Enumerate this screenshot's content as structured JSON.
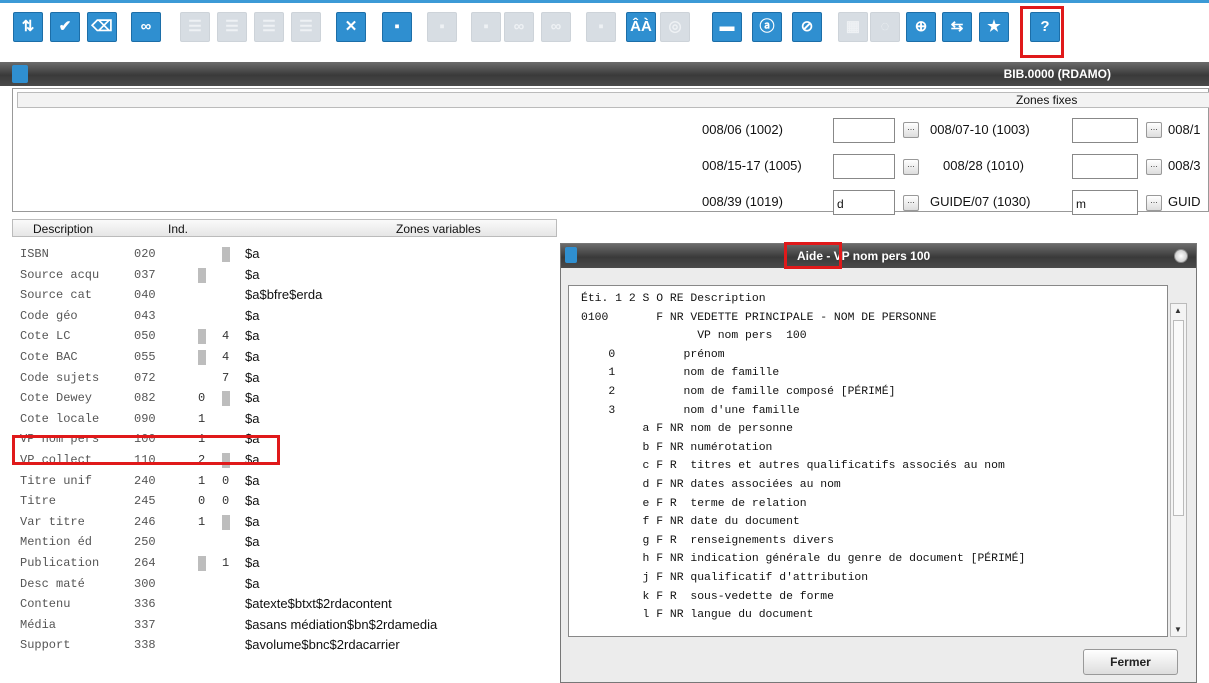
{
  "toolbar": {
    "buttons": [
      {
        "name": "import-icon",
        "glyph": "⇅"
      },
      {
        "name": "validate-icon",
        "glyph": "✔"
      },
      {
        "name": "eraser-icon",
        "glyph": "⌫"
      },
      {
        "name": "binoculars-icon",
        "glyph": "∞"
      },
      {
        "name": "list-icon",
        "glyph": "☰"
      },
      {
        "name": "list-icon",
        "glyph": "☰"
      },
      {
        "name": "list-icon",
        "glyph": "☰"
      },
      {
        "name": "list-indent-icon",
        "glyph": "☰"
      },
      {
        "name": "delete-record-icon",
        "glyph": "✕"
      },
      {
        "name": "record-icon",
        "glyph": "▪"
      },
      {
        "name": "record-icon",
        "glyph": "▪"
      },
      {
        "name": "record-icon",
        "glyph": "▪"
      },
      {
        "name": "binoculars-icon",
        "glyph": "∞"
      },
      {
        "name": "binoculars-icon",
        "glyph": "∞"
      },
      {
        "name": "record-icon",
        "glyph": "▪"
      },
      {
        "name": "accents-icon",
        "glyph": "ÂÀ"
      },
      {
        "name": "circle-icon",
        "glyph": "◎"
      },
      {
        "name": "save-icon",
        "glyph": "▬"
      },
      {
        "name": "subfield-a-icon",
        "glyph": "ⓐ"
      },
      {
        "name": "subfield-disabled-icon",
        "glyph": "⊘"
      },
      {
        "name": "grid-icon",
        "glyph": "▦"
      },
      {
        "name": "globe-icon",
        "glyph": "◌"
      },
      {
        "name": "url-globe-icon",
        "glyph": "⊕"
      },
      {
        "name": "transfer-icon",
        "glyph": "⇆"
      },
      {
        "name": "star-icon",
        "glyph": "★"
      },
      {
        "name": "help-icon",
        "glyph": "?"
      }
    ]
  },
  "main": {
    "title": "BIB.0000 (RDAMO)"
  },
  "fixed": {
    "header": "Zones fixes",
    "fields": [
      {
        "label": "008/06 (1002)",
        "value": ""
      },
      {
        "label": "008/07-10 (1003)",
        "value": ""
      },
      {
        "label": "008/1",
        "value": ""
      },
      {
        "label": "008/15-17 (1005)",
        "value": ""
      },
      {
        "label": "008/28 (1010)",
        "value": ""
      },
      {
        "label": "008/3",
        "value": ""
      },
      {
        "label": "008/39 (1019)",
        "value": "d"
      },
      {
        "label": "GUIDE/07 (1030)",
        "value": "m"
      },
      {
        "label": "GUID",
        "value": ""
      }
    ]
  },
  "columns": {
    "description": "Description",
    "ind": "Ind.",
    "zones": "Zones variables"
  },
  "rows": [
    {
      "desc": "ISBN",
      "code": "020",
      "i1": "",
      "i2": "",
      "s1": false,
      "s2": true,
      "zone": "$a"
    },
    {
      "desc": "Source acqu",
      "code": "037",
      "i1": "",
      "i2": "",
      "s1": true,
      "s2": false,
      "zone": "$a"
    },
    {
      "desc": "Source cat",
      "code": "040",
      "i1": "",
      "i2": "",
      "s1": false,
      "s2": false,
      "zone": "$a$bfre$erda"
    },
    {
      "desc": "Code géo",
      "code": "043",
      "i1": "",
      "i2": "",
      "s1": false,
      "s2": false,
      "zone": "$a"
    },
    {
      "desc": "Cote LC",
      "code": "050",
      "i1": "",
      "i2": "4",
      "s1": true,
      "s2": false,
      "zone": "$a"
    },
    {
      "desc": "Cote BAC",
      "code": "055",
      "i1": "",
      "i2": "4",
      "s1": true,
      "s2": false,
      "zone": "$a"
    },
    {
      "desc": "Code sujets",
      "code": "072",
      "i1": "",
      "i2": "7",
      "s1": false,
      "s2": false,
      "zone": "$a"
    },
    {
      "desc": "Cote Dewey",
      "code": "082",
      "i1": "0",
      "i2": "",
      "s1": false,
      "s2": true,
      "zone": "$a"
    },
    {
      "desc": "Cote locale",
      "code": "090",
      "i1": "1",
      "i2": "",
      "s1": false,
      "s2": false,
      "zone": "$a"
    },
    {
      "desc": "VP nom pers",
      "code": "100",
      "i1": "1",
      "i2": "",
      "s1": false,
      "s2": false,
      "zone": "$a"
    },
    {
      "desc": "VP collect",
      "code": "110",
      "i1": "2",
      "i2": "",
      "s1": false,
      "s2": true,
      "zone": "$a"
    },
    {
      "desc": "Titre unif",
      "code": "240",
      "i1": "1",
      "i2": "0",
      "s1": false,
      "s2": false,
      "zone": "$a"
    },
    {
      "desc": "Titre",
      "code": "245",
      "i1": "0",
      "i2": "0",
      "s1": false,
      "s2": false,
      "zone": "$a"
    },
    {
      "desc": "Var titre",
      "code": "246",
      "i1": "1",
      "i2": "",
      "s1": false,
      "s2": true,
      "zone": "$a"
    },
    {
      "desc": "Mention éd",
      "code": "250",
      "i1": "",
      "i2": "",
      "s1": false,
      "s2": false,
      "zone": "$a"
    },
    {
      "desc": "Publication",
      "code": "264",
      "i1": "",
      "i2": "1",
      "s1": true,
      "s2": false,
      "zone": "$a"
    },
    {
      "desc": "Desc maté",
      "code": "300",
      "i1": "",
      "i2": "",
      "s1": false,
      "s2": false,
      "zone": "$a"
    },
    {
      "desc": "Contenu",
      "code": "336",
      "i1": "",
      "i2": "",
      "s1": false,
      "s2": false,
      "zone": "$atexte$btxt$2rdacontent"
    },
    {
      "desc": "Média",
      "code": "337",
      "i1": "",
      "i2": "",
      "s1": false,
      "s2": false,
      "zone": "$asans médiation$bn$2rdamedia"
    },
    {
      "desc": "Support",
      "code": "338",
      "i1": "",
      "i2": "",
      "s1": false,
      "s2": false,
      "zone": "$avolume$bnc$2rdacarrier"
    }
  ],
  "dialog": {
    "title": "Aide - VP nom pers  100",
    "help_text": "Éti. 1 2 S O RE Description\n0100       F NR VEDETTE PRINCIPALE - NOM DE PERSONNE\n                 VP nom pers  100\n    0          prénom\n    1          nom de famille\n    2          nom de famille composé [PÉRIMÉ]\n    3          nom d'une famille\n         a F NR nom de personne\n         b F NR numérotation\n         c F R  titres et autres qualificatifs associés au nom\n         d F NR dates associées au nom\n         e F R  terme de relation\n         f F NR date du document\n         g F R  renseignements divers\n         h F NR indication générale du genre de document [PÉRIMÉ]\n         j F NR qualificatif d'attribution\n         k F R  sous-vedette de forme\n         l F NR langue du document",
    "close_label": "Fermer"
  }
}
